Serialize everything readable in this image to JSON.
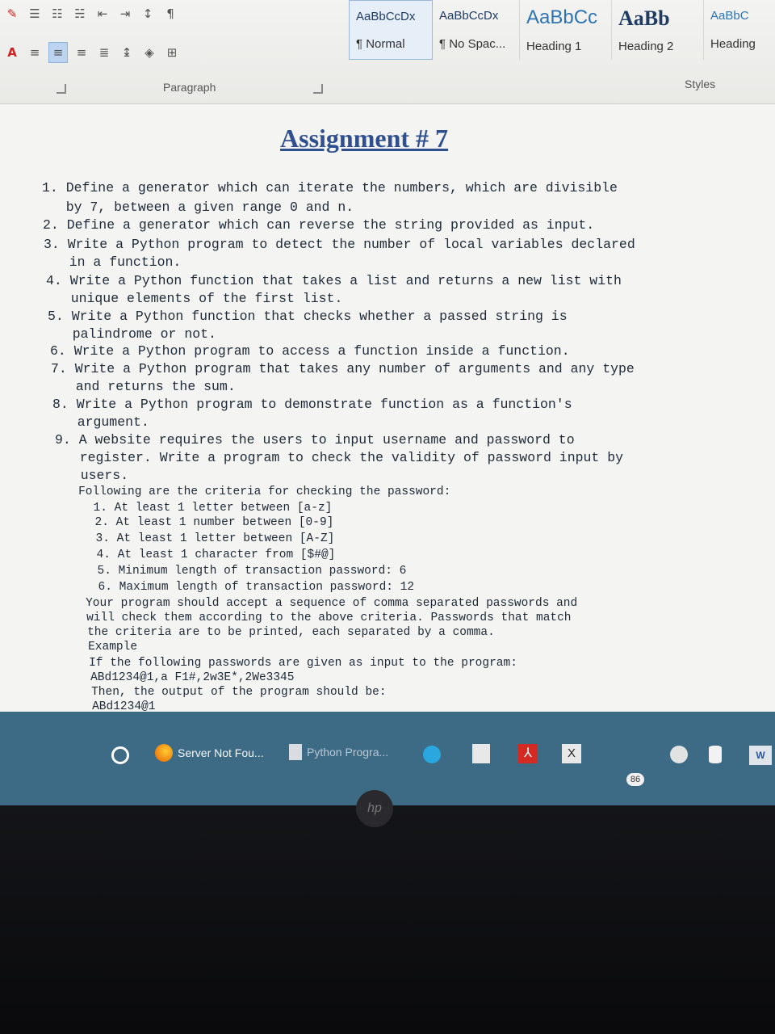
{
  "ribbon": {
    "paragraph_label": "Paragraph",
    "styles_label": "Styles",
    "styles": [
      {
        "preview": "AaBbCcDx",
        "name": "¶ Normal",
        "selected": true
      },
      {
        "preview": "AaBbCcDx",
        "name": "¶ No Spac..."
      },
      {
        "preview": "AaBbCc",
        "name": "Heading 1"
      },
      {
        "preview": "AaBb",
        "name": "Heading 2"
      },
      {
        "preview": "AaBbC",
        "name": "Heading"
      }
    ],
    "icons": [
      "bullets-icon",
      "numbering-icon",
      "multilevel-list-icon",
      "decrease-indent-icon",
      "increase-indent-icon",
      "sort-icon",
      "show-marks-icon",
      "font-color-icon",
      "align-left-icon",
      "center-icon",
      "align-right-icon",
      "justify-icon",
      "line-spacing-icon",
      "shading-icon",
      "borders-icon"
    ]
  },
  "document": {
    "title": "Assignment # 7",
    "lines": [
      "1. Define a generator which can iterate the numbers, which are divisible",
      "   by 7, between a given range 0 and n.",
      "2. Define a generator which can reverse the string provided as input.",
      "3. Write a Python program to detect the number of local variables declared",
      "   in a function.",
      "4. Write a Python function that takes a list and returns a new list with",
      "   unique elements of the first list.",
      "5. Write a Python function that checks whether a passed string is",
      "   palindrome or not.",
      "6. Write a Python program to access a function inside a function.",
      "7. Write a Python program that takes any number of arguments and any type",
      "   and returns the sum.",
      "8. Write a Python program to demonstrate function as a function's",
      "   argument.",
      "9. A website requires the users to input username and password to",
      "   register. Write a program to check the validity of password input by",
      "   users.",
      "   Following are the criteria for checking the password:",
      "     1. At least 1 letter between [a-z]",
      "     2. At least 1 number between [0-9]",
      "     3. At least 1 letter between [A-Z]",
      "     4. At least 1 character from [$#@]",
      "     5. Minimum length of transaction password: 6",
      "     6. Maximum length of transaction password: 12",
      "   Your program should accept a sequence of comma separated passwords and",
      "   will check them according to the above criteria. Passwords that match",
      "   the criteria are to be printed, each separated by a comma.",
      "   Example",
      "   If the following passwords are given as input to the program:",
      "   ABd1234@1,a F1#,2w3E*,2We3345",
      "   Then, the output of the program should be:",
      "   ABd1234@1"
    ]
  },
  "taskbar": {
    "tasks": [
      {
        "label": "Server Not Fou...",
        "icon": "firefox-icon"
      },
      {
        "label": "Python Progra...",
        "icon": "word-doc-icon"
      }
    ],
    "badge": "86",
    "word_label": "W"
  },
  "bezel": {
    "brand": "hp"
  }
}
